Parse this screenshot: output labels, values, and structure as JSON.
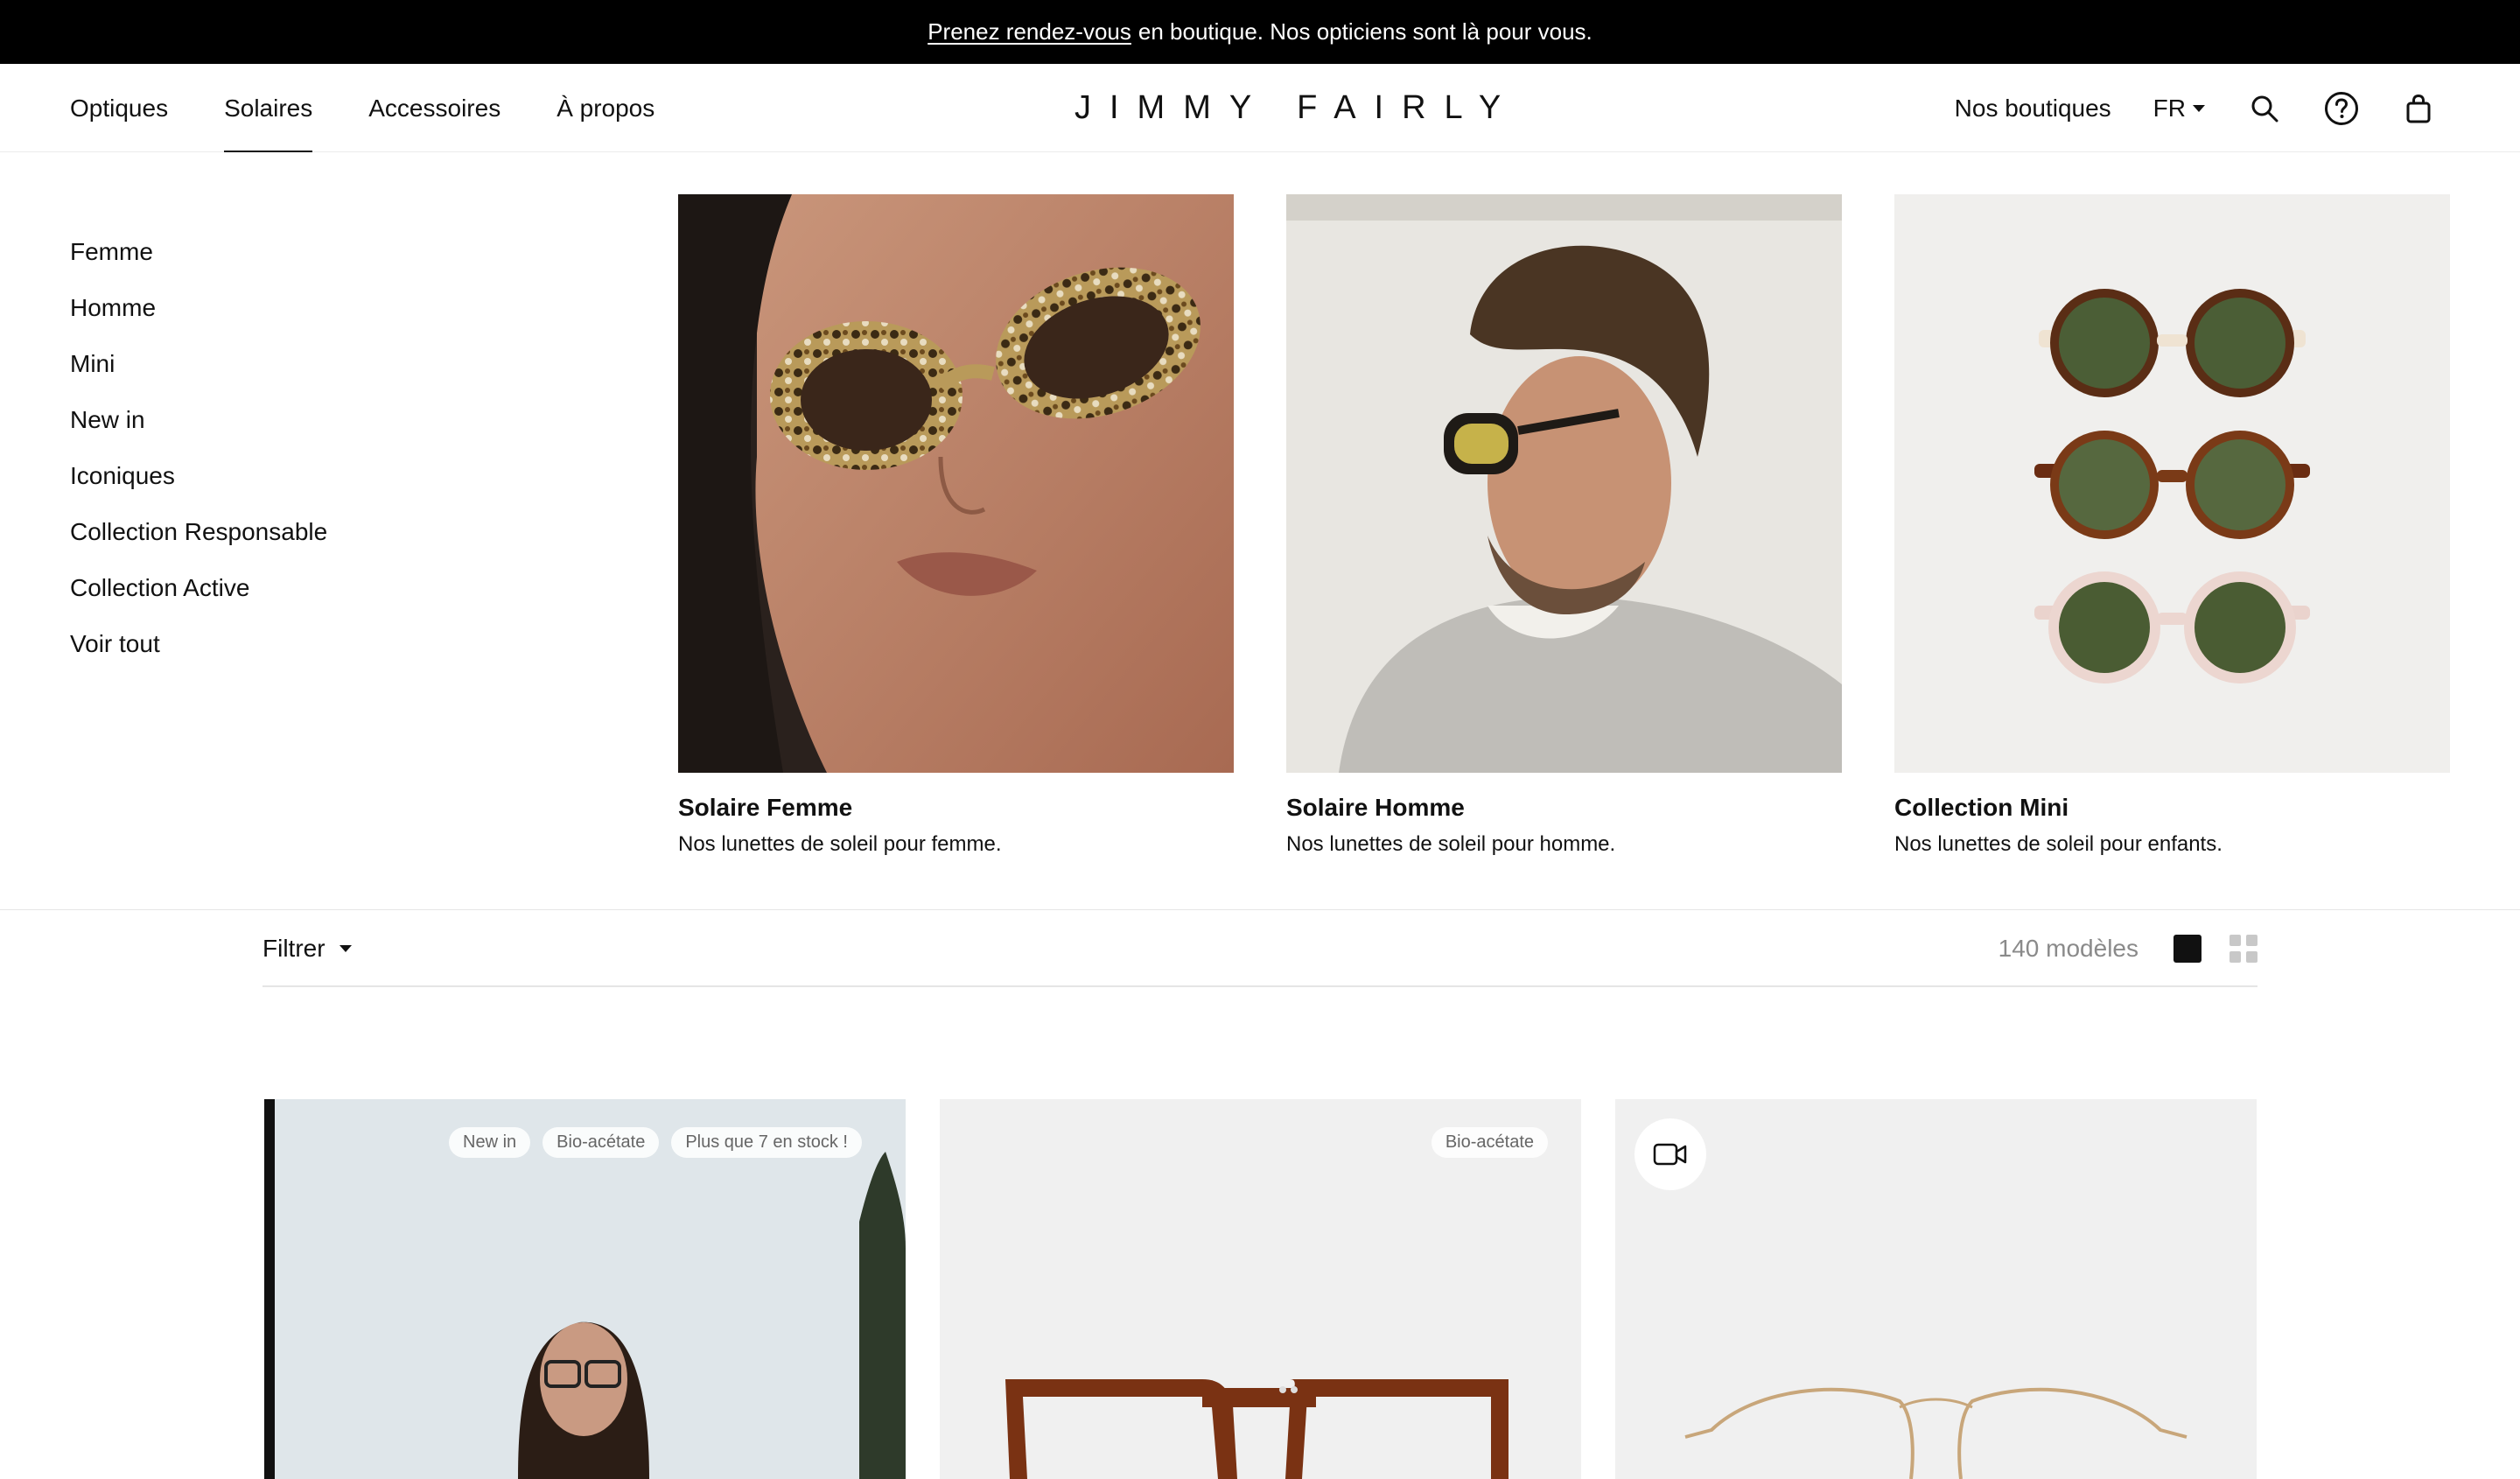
{
  "announcement": {
    "link": "Prenez rendez-vous",
    "text": "en boutique. Nos opticiens sont là pour vous."
  },
  "nav": {
    "items": [
      "Optiques",
      "Solaires",
      "Accessoires",
      "À propos"
    ],
    "active": "Solaires"
  },
  "logo": "JIMMY FAIRLY",
  "header_right": {
    "stores": "Nos boutiques",
    "lang": "FR",
    "icons": [
      "search-icon",
      "help-icon",
      "bag-icon"
    ]
  },
  "mega_menu": {
    "links": [
      "Femme",
      "Homme",
      "Mini",
      "New in",
      "Iconiques",
      "Collection Responsable",
      "Collection Active",
      "Voir tout"
    ],
    "cards": [
      {
        "title": "Solaire Femme",
        "subtitle": "Nos lunettes de soleil pour femme."
      },
      {
        "title": "Solaire Homme",
        "subtitle": "Nos lunettes de soleil pour homme."
      },
      {
        "title": "Collection Mini",
        "subtitle": "Nos lunettes de soleil pour enfants."
      }
    ]
  },
  "toolbar": {
    "filter": "Filtrer",
    "count": "140 modèles"
  },
  "products": [
    {
      "badges": [
        "New in",
        "Bio-acétate",
        "Plus que 7 en stock !"
      ]
    },
    {
      "badges": [
        "Bio-acétate"
      ]
    },
    {
      "badges": [],
      "icon": "video-camera-icon"
    }
  ],
  "colors": {
    "announcement_bg": "#000000",
    "text": "#111111",
    "muted": "#8a8a8a",
    "product_bg": "#f0f0f0"
  }
}
